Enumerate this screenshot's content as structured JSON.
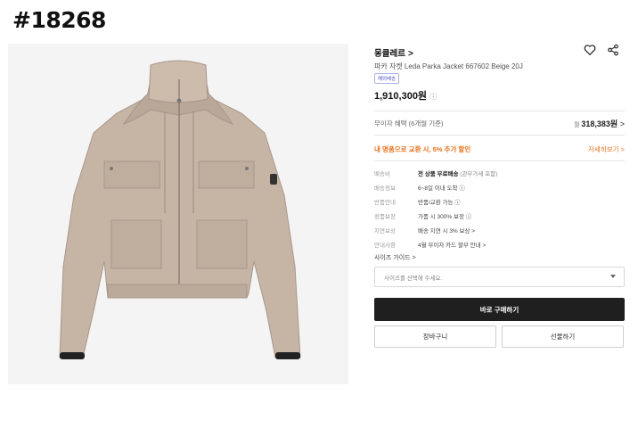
{
  "tag": "#18268",
  "product": {
    "brand": "몽클레르",
    "brand_chevron": ">",
    "name": "파카 자켓 Leda Parka Jacket 667602 Beige 20J",
    "badge": "해외배송",
    "price": "1,910,300원",
    "price_info_icon": "ⓘ",
    "wishlist_icon": "heart-icon",
    "share_icon": "share-icon"
  },
  "installment": {
    "label": "무이자 혜택 (6개월 기준)",
    "prefix": "월",
    "amount": "318,383원",
    "chevron": ">"
  },
  "promo": {
    "text": "내 명품으로 교환 시, 5% 추가 할인",
    "link": "자세히보기",
    "chevron": ">"
  },
  "specs": [
    {
      "key": "배송비",
      "value_bold": "전 상품 무료배송",
      "value_rest": " (관부가세 포함)"
    },
    {
      "key": "배송정보",
      "value_bold": "",
      "value_rest": "6~8일 이내 도착 ⓘ"
    },
    {
      "key": "반품안내",
      "value_bold": "",
      "value_rest": "반품/교환 가능 ⓘ"
    },
    {
      "key": "정품보장",
      "value_bold": "",
      "value_rest": "가품 시 300% 보장 ⓘ"
    },
    {
      "key": "지연보상",
      "value_bold": "",
      "value_rest": "배송 지연 시 3% 보상 >"
    },
    {
      "key": "안내사항",
      "value_bold": "",
      "value_rest": "4월 무이자 카드 할부 안내 >"
    }
  ],
  "size_guide": "사이즈 가이드 >",
  "size_select": {
    "placeholder": "사이즈를 선택해 주세요."
  },
  "buttons": {
    "buy": "바로 구매하기",
    "cart": "장바구니",
    "gift": "선물하기"
  },
  "colors": {
    "accent": "#e8721c",
    "buy_bg": "#1f1f1f",
    "badge": "#4a57c9"
  }
}
